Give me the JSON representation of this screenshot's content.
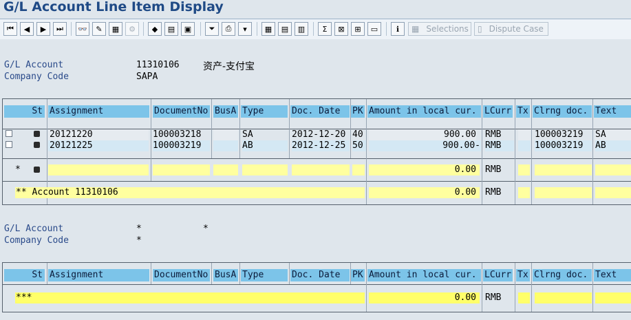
{
  "window": {
    "title": "G/L Account Line Item Display"
  },
  "toolbar": {
    "selections_label": "Selections",
    "dispute_case_label": "Dispute Case"
  },
  "header1": {
    "gl_account_label": "G/L Account",
    "gl_account_value": "11310106",
    "gl_account_text": "资产-支付宝",
    "company_code_label": "Company Code",
    "company_code_value": "SAPA"
  },
  "columns": {
    "st": "St",
    "assignment": "Assignment",
    "document_no": "DocumentNo",
    "bus_a": "BusA",
    "type": "Type",
    "doc_date": "Doc. Date",
    "pk": "PK",
    "amount": "Amount in local cur.",
    "lcurr": "LCurr",
    "tx": "Tx",
    "clrng_doc": "Clrng doc.",
    "text": "Text"
  },
  "table1": {
    "rows": [
      {
        "assignment": "20121220",
        "document_no": "100003218",
        "bus_a": "",
        "type": "SA",
        "doc_date": "2012-12-20",
        "pk": "40",
        "amount": "900.00",
        "lcurr": "RMB",
        "tx": "",
        "clrng_doc": "100003219",
        "text": "SA"
      },
      {
        "assignment": "20121225",
        "document_no": "100003219",
        "bus_a": "",
        "type": "AB",
        "doc_date": "2012-12-25",
        "pk": "50",
        "amount": "900.00-",
        "lcurr": "RMB",
        "tx": "",
        "clrng_doc": "100003219",
        "text": "AB"
      }
    ],
    "subtotal": {
      "marker": "*",
      "amount": "0.00",
      "lcurr": "RMB"
    },
    "account_total": {
      "label": "** Account 11310106",
      "amount": "0.00",
      "lcurr": "RMB"
    }
  },
  "header2": {
    "gl_account_label": "G/L Account",
    "gl_account_value": "*",
    "gl_account_text": "*",
    "company_code_label": "Company Code",
    "company_code_value": "*"
  },
  "table2": {
    "grand_total": {
      "label": "***",
      "amount": "0.00",
      "lcurr": "RMB"
    }
  },
  "colors": {
    "header_blue": "#7cc4e9",
    "total_yellow": "#ffff9f",
    "grand_total_yellow": "#ffff6a",
    "title_blue": "#1f4a86"
  }
}
